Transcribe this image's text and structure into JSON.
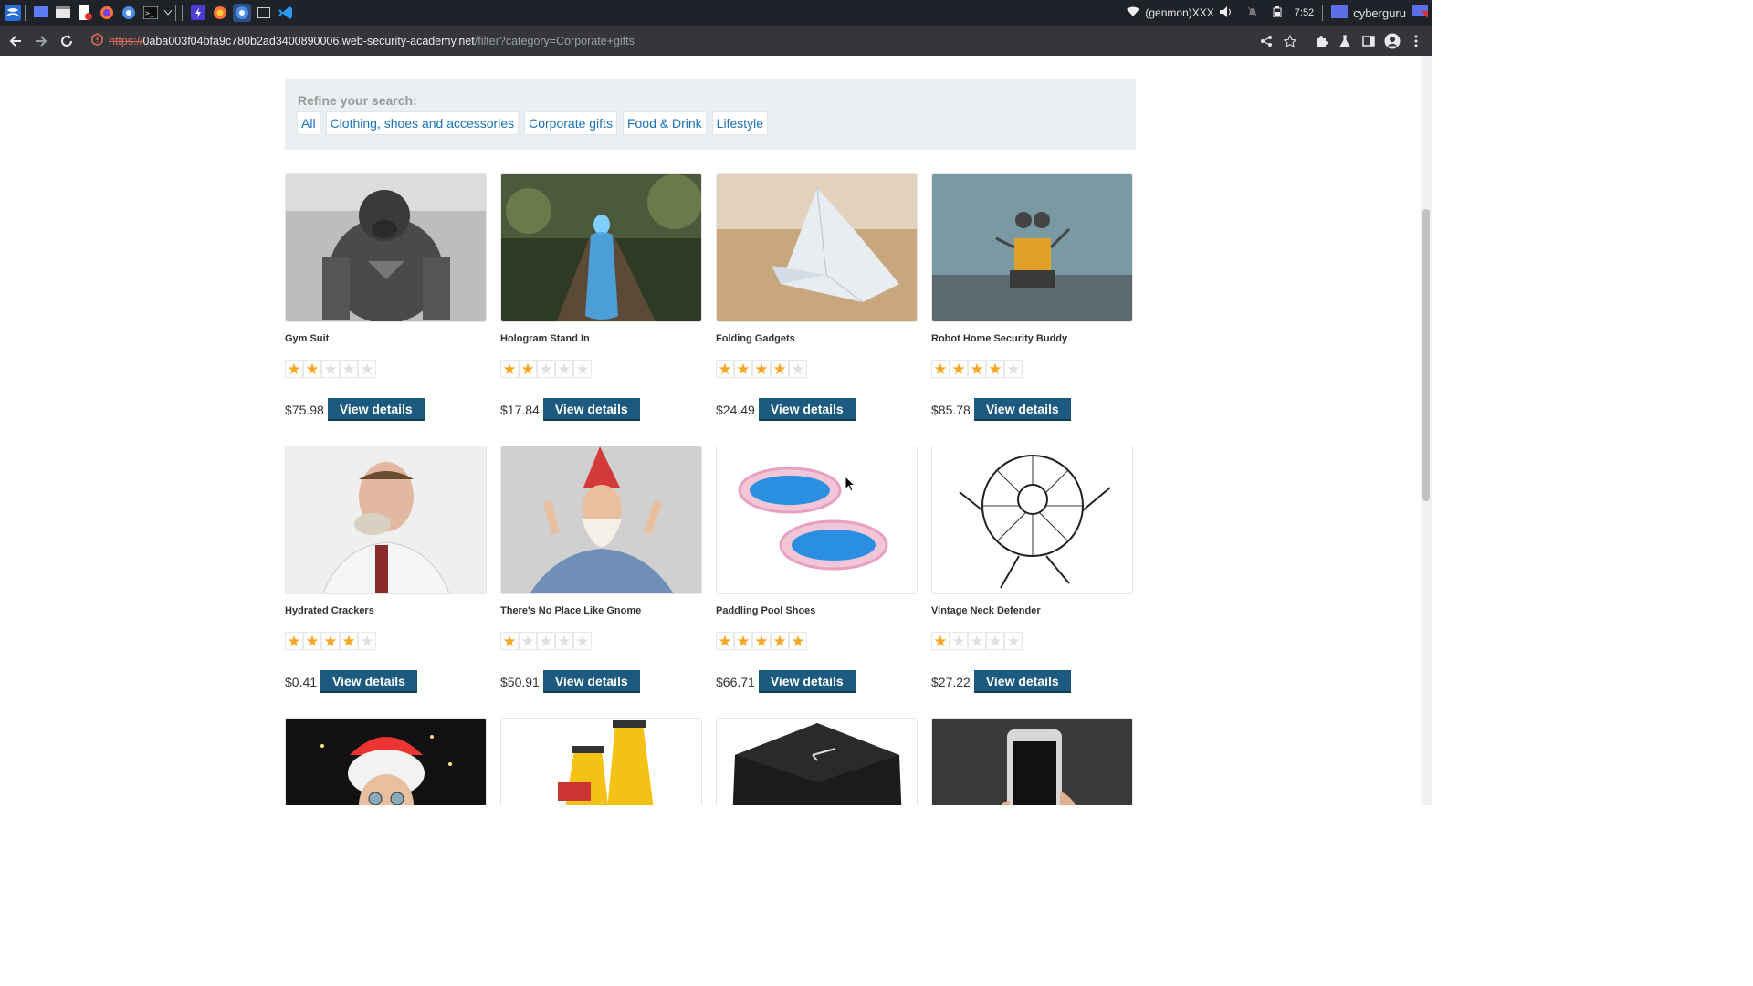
{
  "taskbar": {
    "network": "(genmon)XXX",
    "time": "7:52",
    "user": "cyberguru"
  },
  "browser": {
    "url_scheme": "https://",
    "url_host": "0aba003f04bfa9c780b2ad3400890006.web-security-academy.net",
    "url_path": "/filter?category=Corporate+gifts"
  },
  "filter": {
    "title": "Refine your search:",
    "links": [
      "All",
      "Clothing, shoes and accessories",
      "Corporate gifts",
      "Food & Drink",
      "Lifestyle"
    ]
  },
  "products": [
    {
      "name": "Gym Suit",
      "rating": 2,
      "price": "$75.98",
      "button": "View details"
    },
    {
      "name": "Hologram Stand In",
      "rating": 2,
      "price": "$17.84",
      "button": "View details"
    },
    {
      "name": "Folding Gadgets",
      "rating": 4,
      "price": "$24.49",
      "button": "View details"
    },
    {
      "name": "Robot Home Security Buddy",
      "rating": 4,
      "price": "$85.78",
      "button": "View details"
    },
    {
      "name": "Hydrated Crackers",
      "rating": 4,
      "price": "$0.41",
      "button": "View details"
    },
    {
      "name": "There's No Place Like Gnome",
      "rating": 1,
      "price": "$50.91",
      "button": "View details"
    },
    {
      "name": "Paddling Pool Shoes",
      "rating": 5,
      "price": "$66.71",
      "button": "View details"
    },
    {
      "name": "Vintage Neck Defender",
      "rating": 1,
      "price": "$27.22",
      "button": "View details"
    }
  ],
  "colors": {
    "accent": "#1c5a7f",
    "link": "#1a72b8",
    "star": "#f5a623"
  }
}
